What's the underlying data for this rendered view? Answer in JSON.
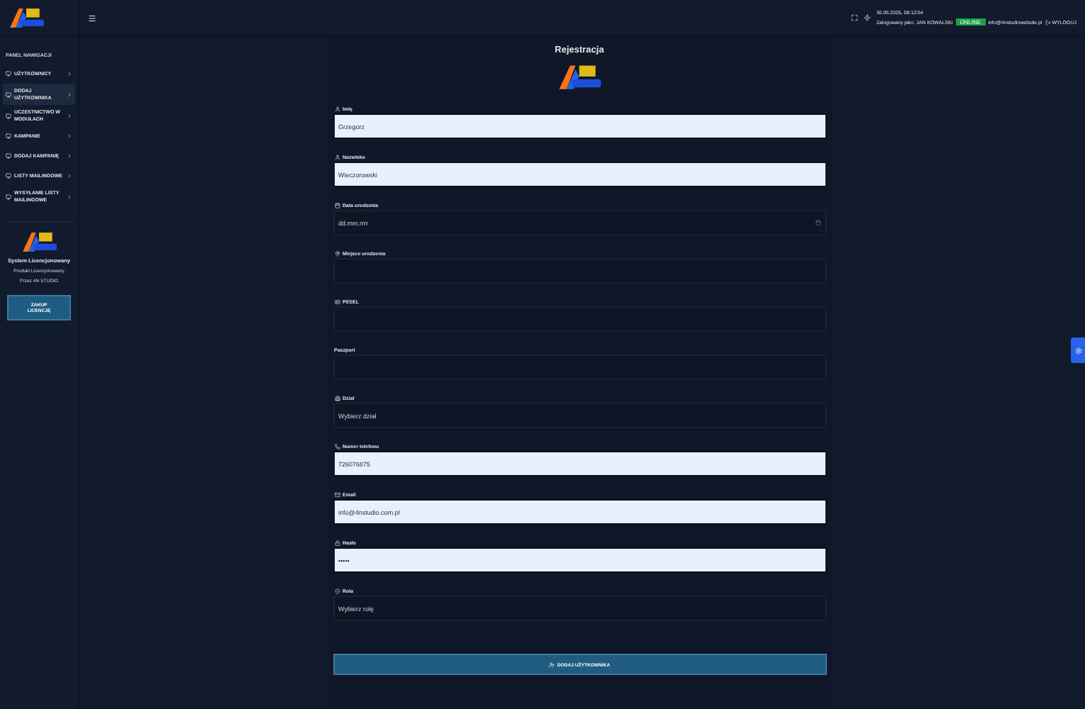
{
  "sidebar": {
    "section_title": "PANEL NAWIGACJI",
    "items": [
      {
        "label": "UŻYTKOWNICY",
        "selected": false
      },
      {
        "label": "DODAJ UŻYTKOWNIKA",
        "selected": true
      },
      {
        "label": "UCZESTNICTWO W MODUŁACH",
        "selected": false
      },
      {
        "label": "KAMPANIE",
        "selected": false
      },
      {
        "label": "DODAJ KAMPANIĘ",
        "selected": false
      },
      {
        "label": "LISTY MAILINGOWE",
        "selected": false
      },
      {
        "label": "WYSYŁANIE LISTY MAILINGOWE",
        "selected": false
      }
    ],
    "license": {
      "title": "System Licencjonowany",
      "line_1": "Produkt Licencjonowany",
      "line_2": "Przez 4N STUDIO",
      "button": "ZAKUP LICENCJĘ"
    }
  },
  "header": {
    "datetime": "30.05.2025, 08:12:54",
    "user": "Zalogowany jako: JAN KOWALSKI",
    "status": "ONLINE",
    "email": "info@4nstudiowebsite.pl",
    "logout": "WYLOGUJ"
  },
  "form": {
    "title": "Rejestracja",
    "fields": [
      {
        "label": "Imię",
        "kind": "text",
        "value": "Grzegorz",
        "autofilled": true
      },
      {
        "label": "Nazwisko",
        "kind": "text",
        "value": "Wieczorowski",
        "autofilled": true
      },
      {
        "label": "Data urodzenia",
        "kind": "date",
        "value": "dd.mm.rrrr",
        "autofilled": false
      },
      {
        "label": "Miejsce urodzenia",
        "kind": "text",
        "autofilled": false
      },
      {
        "label": "PESEL",
        "kind": "text",
        "autofilled": false
      },
      {
        "label": "Paszport",
        "kind": "text",
        "autofilled": false
      },
      {
        "label": "Dział",
        "kind": "select",
        "value": "Wybierz dział",
        "autofilled": false
      },
      {
        "label": "Numer telefonu",
        "kind": "text",
        "value": "726076875",
        "autofilled": true
      },
      {
        "label": "Email",
        "kind": "text",
        "value": "info@4nstudio.com.pl",
        "autofilled": true
      },
      {
        "label": "Hasło",
        "kind": "password",
        "value": "•••••",
        "autofilled": true
      },
      {
        "label": "Rola",
        "kind": "select",
        "value": "Wybierz rolę",
        "autofilled": false
      }
    ],
    "submit": "DODAJ UŻYTKOWNIKA"
  }
}
